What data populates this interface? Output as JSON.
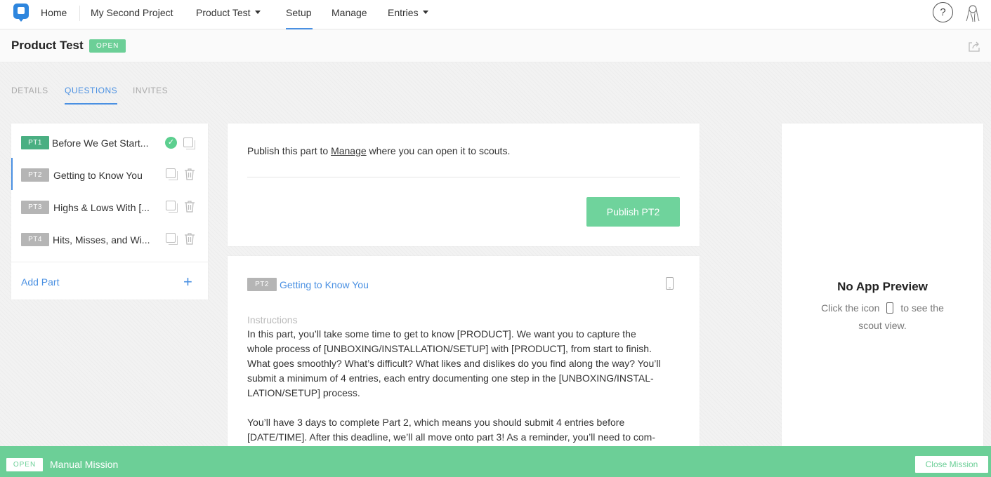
{
  "nav": {
    "home": "Home",
    "project": "My Second Project",
    "product": "Product Test",
    "setup": "Setup",
    "manage": "Manage",
    "entries": "Entries",
    "help": "?"
  },
  "title_bar": {
    "title": "Product Test",
    "badge": "OPEN"
  },
  "tabs": [
    {
      "label": "DETAILS",
      "active": false
    },
    {
      "label": "QUESTIONS",
      "active": true
    },
    {
      "label": "INVITES",
      "active": false
    }
  ],
  "parts": [
    {
      "tag": "PT1",
      "name": "Before We Get Start...",
      "published": true,
      "tag_color": "#4aaf82"
    },
    {
      "tag": "PT2",
      "name": "Getting to Know You",
      "published": false,
      "selected": true,
      "tag_color": "#b5b5b5"
    },
    {
      "tag": "PT3",
      "name": "Highs & Lows With [...",
      "published": false,
      "tag_color": "#b5b5b5"
    },
    {
      "tag": "PT4",
      "name": "Hits, Misses, and Wi...",
      "published": false,
      "tag_color": "#b5b5b5"
    }
  ],
  "add_part": {
    "label": "Add Part",
    "icon": "+"
  },
  "publish": {
    "text_before": "Publish this part to ",
    "link": "Manage",
    "text_after": " where you can open it to scouts.",
    "button": "Publish PT2"
  },
  "detail": {
    "tag": "PT2",
    "name": "Getting to Know You",
    "instructions_label": "Instructions",
    "paragraph1": "In this part, you’ll take some time to get to know [PRODUCT]. We want you to capture the\nwhole process of [UNBOXING/INSTALLATION/SETUP] with [PRODUCT], from start to finish.\nWhat goes smoothly? What’s difficult? What likes and dislikes do you find along the way? You’ll\nsubmit a minimum of 4 entries, each entry documenting one step in the [UNBOXING/INSTAL-\nLATION/SETUP] process.",
    "paragraph2": "You’ll have 3 days to complete Part 2, which means you should submit 4 entries before\n[DATE/TIME]. After this deadline, we’ll all move onto part 3! As a reminder, you’ll need to com-"
  },
  "preview": {
    "title": "No App Preview",
    "hint_before": "Click the icon",
    "hint_after": "to see the scout view."
  },
  "footer": {
    "badge": "OPEN",
    "title": "Manual Mission",
    "close": "Close Mission"
  },
  "colors": {
    "accent": "#4a90e2",
    "success": "#6ccf97"
  }
}
